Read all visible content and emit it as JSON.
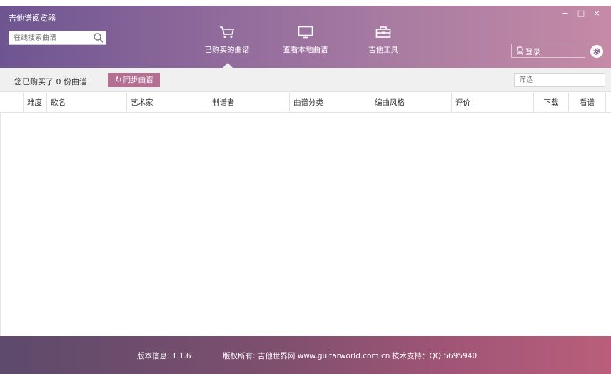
{
  "app": {
    "title": "吉他谱阅览器",
    "window_controls": {
      "minimize": "−",
      "maximize": "□",
      "close": "×"
    }
  },
  "search": {
    "placeholder": "在线搜索曲谱",
    "icon": "search-icon"
  },
  "nav": {
    "tabs": [
      {
        "label": "已购买的曲谱",
        "icon": "cart-icon",
        "active": true
      },
      {
        "label": "查看本地曲谱",
        "icon": "monitor-icon",
        "active": false
      },
      {
        "label": "吉他工具",
        "icon": "toolbox-icon",
        "active": false
      }
    ]
  },
  "account": {
    "login_label": "登录",
    "icon": "user-icon"
  },
  "settings": {
    "icon": "gear-icon"
  },
  "toolbar": {
    "purchase_count_text": "您已购买了 0 份曲谱",
    "sync_label": "同步曲谱",
    "filter_placeholder": "筛选"
  },
  "table": {
    "columns": [
      "难度",
      "歌名",
      "艺术家",
      "制谱者",
      "曲谱分类",
      "编曲风格",
      "评价",
      "下载",
      "看谱"
    ],
    "rows": []
  },
  "footer": {
    "version": "版本信息: 1.1.6",
    "copyright": "版权所有: 吉他世界网 www.guitarworld.com.cn",
    "support": "技术支持：QQ 5695940"
  },
  "colors": {
    "header_start": "#6e5591",
    "header_end": "#c58aa6",
    "accent": "#b56f93",
    "footer_start": "#5d4a6c",
    "footer_end": "#b95f7b"
  }
}
